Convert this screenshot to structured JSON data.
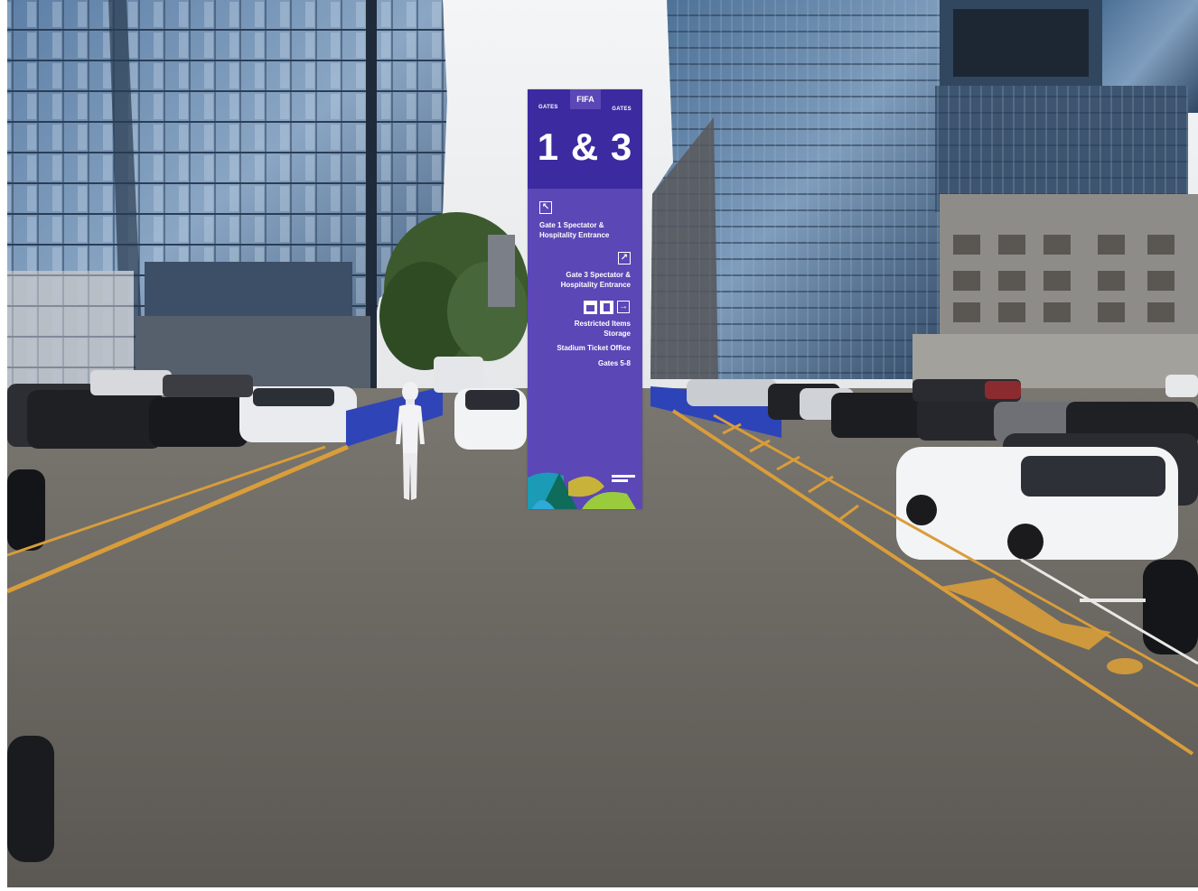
{
  "scene": {
    "description_colors": {
      "sky": "#eef0f2",
      "asphalt": "#6c6862",
      "lane_line": "#e0a43c",
      "barrier": "#2d43b8"
    }
  },
  "sign": {
    "top_left_label": "GATES",
    "top_right_label": "GATES",
    "tab_label": "FIFA",
    "gate_numbers": "1 & 3",
    "colors": {
      "body": "#5b47b5",
      "header": "#3b2aa0"
    },
    "directions": [
      {
        "icon": "arrow-up-left-icon",
        "line1": "Gate 1 Spectator &",
        "line2": "Hospitality Entrance"
      },
      {
        "icon": "arrow-up-right-icon",
        "line1": "Gate 3 Spectator &",
        "line2": "Hospitality Entrance"
      },
      {
        "icons": [
          "bag-icon",
          "locker-icon",
          "arrow-right-icon"
        ],
        "line1": "Restricted Items",
        "line2": "Storage"
      },
      {
        "line1": "Stadium Ticket Office"
      },
      {
        "line1": "Gates 5-8"
      }
    ]
  }
}
